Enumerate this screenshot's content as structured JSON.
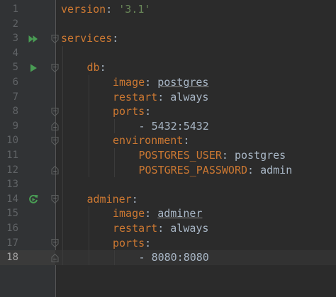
{
  "editor": {
    "colors": {
      "background": "#2b2b2b",
      "gutter": "#313335",
      "key": "#cc7832",
      "string": "#6a8759",
      "value": "#a9b7c6",
      "run_icon": "#499c54"
    },
    "current_line": 18,
    "lines": [
      {
        "n": "1",
        "indent": 0,
        "key": "version",
        "colon": ": ",
        "string": "'3.1'"
      },
      {
        "n": "2"
      },
      {
        "n": "3",
        "indent": 0,
        "key": "services",
        "colon": ":",
        "gutter_icon": "run-all-icon",
        "fold": "open"
      },
      {
        "n": "4"
      },
      {
        "n": "5",
        "indent": 1,
        "key": "db",
        "colon": ":",
        "gutter_icon": "run-icon",
        "fold": "open"
      },
      {
        "n": "6",
        "indent": 2,
        "key": "image",
        "colon": ": ",
        "value": "postgres",
        "underline": true
      },
      {
        "n": "7",
        "indent": 2,
        "key": "restart",
        "colon": ": ",
        "value": "always"
      },
      {
        "n": "8",
        "indent": 2,
        "key": "ports",
        "colon": ":",
        "fold": "open"
      },
      {
        "n": "9",
        "indent": 3,
        "dash": "- ",
        "value": "5432:5432",
        "fold": "close"
      },
      {
        "n": "10",
        "indent": 2,
        "key": "environment",
        "colon": ":",
        "fold": "open"
      },
      {
        "n": "11",
        "indent": 3,
        "key": "POSTGRES_USER",
        "colon": ": ",
        "value": "postgres"
      },
      {
        "n": "12",
        "indent": 3,
        "key": "POSTGRES_PASSWORD",
        "colon": ": ",
        "value": "admin",
        "fold": "close"
      },
      {
        "n": "13"
      },
      {
        "n": "14",
        "indent": 1,
        "key": "adminer",
        "colon": ":",
        "gutter_icon": "rerun-icon",
        "fold": "open"
      },
      {
        "n": "15",
        "indent": 2,
        "key": "image",
        "colon": ": ",
        "value": "adminer",
        "underline": true
      },
      {
        "n": "16",
        "indent": 2,
        "key": "restart",
        "colon": ": ",
        "value": "always"
      },
      {
        "n": "17",
        "indent": 2,
        "key": "ports",
        "colon": ":",
        "fold": "open"
      },
      {
        "n": "18",
        "indent": 3,
        "dash": "- ",
        "value": "8080:8080",
        "fold": "close"
      }
    ]
  }
}
